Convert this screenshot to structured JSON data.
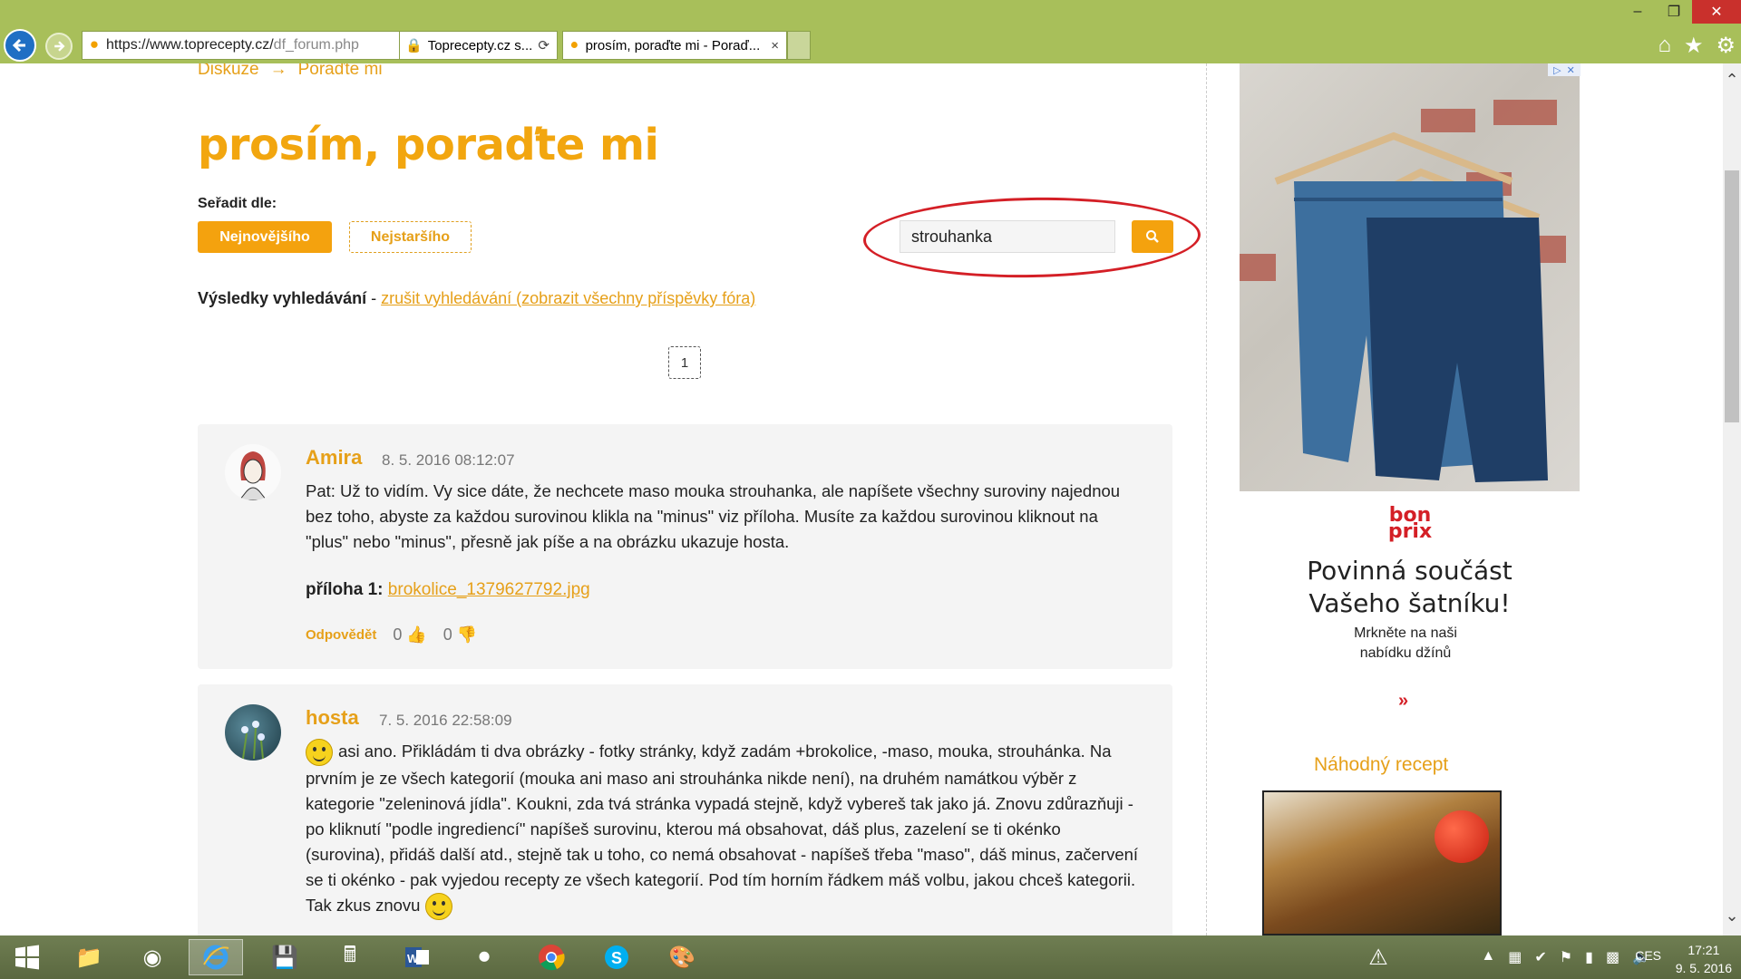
{
  "browser": {
    "url_main": "https://www.toprecepty.cz/",
    "url_rest": "df_forum.php",
    "tab1_label": "Toprecepty.cz s...",
    "tab2_label": "prosím, poraďte mi - Porаď...",
    "tab_close": "×"
  },
  "breadcrumb": {
    "item1": "Diskuze",
    "arrow": "→",
    "item2": "Poraďte mi"
  },
  "page": {
    "title": "prosím, poraďte mi",
    "sort_label": "Seřadit dle:",
    "sort_newest": "Nejnovějšího",
    "sort_oldest": "Nejstaršího",
    "search_value": "strouhanka",
    "results_label": "Výsledky vyhledávání",
    "results_dash": " - ",
    "results_cancel": "zrušit vyhledávání (zobrazit všechny příspěvky fóra)",
    "page_number": "1"
  },
  "posts": [
    {
      "author": "Amira",
      "date": "8. 5. 2016 08:12:07",
      "text": "Pat: Už to vidím. Vy sice dáte, že nechcete maso mouka strouhanka, ale napíšete všechny suroviny najednou bez toho, abyste za každou surovinou klikla na \"minus\" viz příloha. Musíte za každou surovinou kliknout na \"plus\" nebo \"minus\", přesně jak píše a na obrázku ukazuje hosta.",
      "attach_label": "příloha 1:",
      "attach_file": "brokolice_1379627792.jpg",
      "reply": "Odpovědět",
      "likes": "0",
      "dislikes": "0"
    },
    {
      "author": "hosta",
      "date": "7. 5. 2016 22:58:09",
      "text": "asi ano. Přikládám ti dva obrázky - fotky stránky, když zadám +brokolice, -maso, mouka, strouhánka. Na prvním je ze všech kategorií (mouka ani maso ani strouhánka nikde není), na druhém namátkou výběr z kategorie \"zeleninová jídla\". Koukni, zda tvá stránka vypadá stejně, když vybereš tak jako já. Znovu zdůrazňuji - po kliknutí \"podle ingrediencí\" napíšeš surovinu, kterou má obsahovat, dáš plus, zazelení se ti okénko (surovina), přidáš další atd., stejně tak u toho, co nemá obsahovat - napíšeš třeba \"maso\", dáš minus, začervení se ti okénko - pak vyjedou recepty ze všech kategorií. Pod tím horním řádkem máš volbu, jakou chceš kategorii. Tak zkus znovu"
    }
  ],
  "ad": {
    "brand_line1": "bon",
    "brand_line2": "prix",
    "headline_line1": "Povinná součást",
    "headline_line2": "Vašeho šatníku!",
    "sub_line1": "Mrkněte na naši",
    "sub_line2": "nabídku džínů",
    "more": "»"
  },
  "sidebar": {
    "random_recipe_title": "Náhodný recept"
  },
  "taskbar": {
    "lang": "CES",
    "time": "17:21",
    "date": "9. 5. 2016"
  },
  "colors": {
    "accent": "#f4a20e",
    "link": "#e6a019",
    "chrome": "#a8bf5a",
    "highlight_ellipse": "#d41f26"
  }
}
